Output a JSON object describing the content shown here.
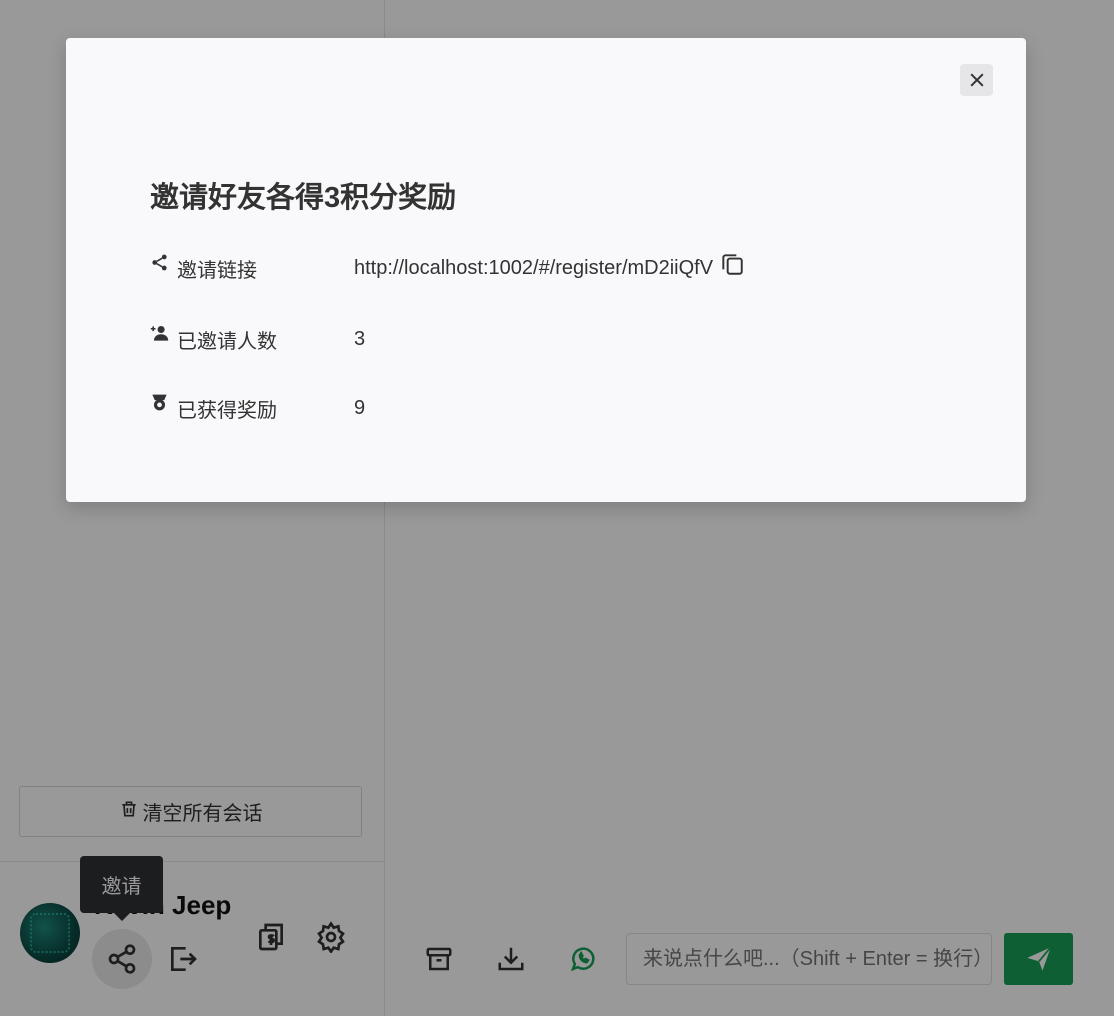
{
  "sidebar": {
    "clear_button_label": "清空所有会话",
    "user": {
      "name": "Kevin Jeep"
    },
    "tooltip": "邀请"
  },
  "chat": {
    "input_placeholder": "来说点什么吧...（Shift + Enter = 换行）"
  },
  "modal": {
    "title": "邀请好友各得3积分奖励",
    "rows": {
      "link": {
        "label": "邀请链接",
        "value": "http://localhost:1002/#/register/mD2iiQfV"
      },
      "invited": {
        "label": "已邀请人数",
        "value": "3"
      },
      "reward": {
        "label": "已获得奖励",
        "value": "9"
      }
    }
  },
  "colors": {
    "primary_green": "#18a058",
    "overlay": "rgba(0,0,0,0.4)",
    "tooltip_bg": "#303133"
  }
}
